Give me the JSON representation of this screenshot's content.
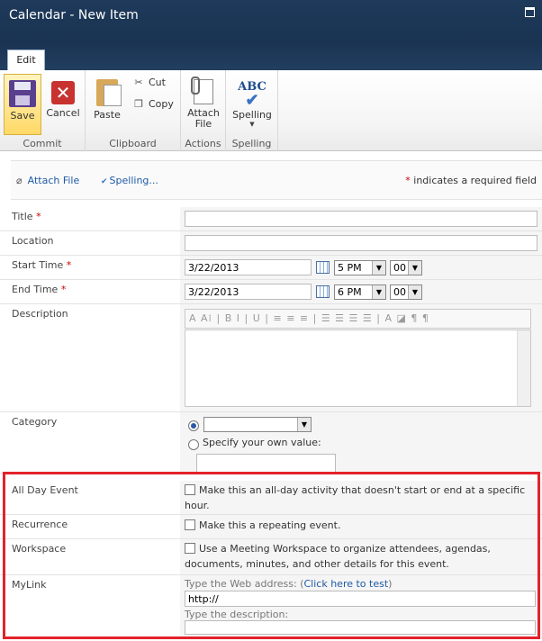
{
  "window": {
    "title": "Calendar - New Item"
  },
  "ribbon": {
    "tab_label": "Edit",
    "save_label": "Save",
    "cancel_label": "Cancel",
    "cancel_glyph": "✕",
    "paste_label": "Paste",
    "cut_label": "Cut",
    "copy_label": "Copy",
    "attach_label_line1": "Attach",
    "attach_label_line2": "File",
    "spelling_label": "Spelling",
    "spelling_icon_text": "ABC",
    "groups": {
      "commit": "Commit",
      "clipboard": "Clipboard",
      "actions": "Actions",
      "spelling": "Spelling"
    }
  },
  "actionbar": {
    "attach_link": "Attach File",
    "spelling_link": "Spelling...",
    "required_star": "*",
    "required_note": " indicates a required field"
  },
  "form": {
    "title_label": "Title",
    "location_label": "Location",
    "start_label": "Start Time",
    "end_label": "End Time",
    "description_label": "Description",
    "category_label": "Category",
    "all_day_label": "All Day Event",
    "recurrence_label": "Recurrence",
    "workspace_label": "Workspace",
    "mylink_label": "MyLink",
    "required_star": "*",
    "start_date": "3/22/2013",
    "start_hour": "5 PM",
    "start_min": "00",
    "end_date": "3/22/2013",
    "end_hour": "6 PM",
    "end_min": "00",
    "category_selected": "",
    "specify_own": "Specify your own value:",
    "all_day_text": "Make this an all-day activity that doesn't start or end at a specific hour.",
    "recurrence_text": "Make this a repeating event.",
    "workspace_text": "Use a Meeting Workspace to organize attendees, agendas, documents, minutes, and other details for this event.",
    "mylink_web_prompt": "Type the Web address: (",
    "mylink_test_link": "Click here to test",
    "mylink_web_close": ")",
    "mylink_url_value": "http://",
    "mylink_desc_prompt": "Type the description:"
  },
  "rte_toolbar": "A  A⁞ | B  I | U | ≡ ≡ ≡ | ☰ ☰ ☰ ☰ | A ◪ ¶ ¶",
  "colors": {
    "header_bg": "#1e3a5a",
    "highlight_border": "#e3222a",
    "link": "#1f5aa6",
    "required": "#cc0000"
  }
}
